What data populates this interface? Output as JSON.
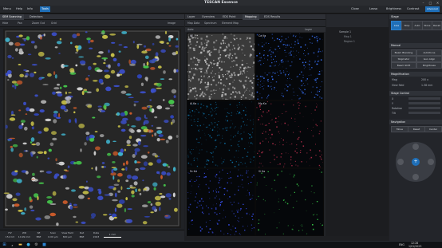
{
  "app": {
    "title": "TESCAN Essence"
  },
  "menubar": {
    "items_left": [
      "Menu",
      "Help",
      "Info",
      "Tools"
    ],
    "items_right": [
      "Close",
      "Lasso",
      "Brightness",
      "Contrast",
      "Advanced"
    ],
    "window_controls": [
      "–",
      "□",
      "✕"
    ]
  },
  "left_panel": {
    "tabs": [
      "SEM Scanning",
      "Detectors"
    ],
    "subbar": [
      "Hide",
      "Pan",
      "Zoom Out",
      "Grid"
    ],
    "image_label": "Image",
    "status": [
      {
        "label": "HV",
        "value": "15.0 kV"
      },
      {
        "label": "WD",
        "value": "14.99 mm"
      },
      {
        "label": "SE",
        "value": "BSE"
      },
      {
        "label": "Scan",
        "value": "0.00 µm"
      },
      {
        "label": "View field",
        "value": "820 µm"
      },
      {
        "label": "Det",
        "value": "BSE"
      },
      {
        "label": "Date",
        "value": "2023"
      }
    ],
    "scale_label": "1 mm"
  },
  "center_panel": {
    "tabs": [
      "Layer",
      "Overview",
      "EDS Point",
      "Mapping",
      "EDS Results"
    ],
    "subtabs": [
      "Map Data",
      "Spectrum",
      "Element Map"
    ],
    "dropdowns": [
      "Auto",
      "Layer"
    ],
    "maps": [
      {
        "label": "SE"
      },
      {
        "label": "Ca Kα"
      },
      {
        "label": "Al Kα"
      },
      {
        "label": "Mg Kα"
      },
      {
        "label": "Fe Kα"
      },
      {
        "label": "Si Kα"
      }
    ]
  },
  "tree_panel": {
    "title": "Sample 1",
    "items": [
      "Map 1",
      "Region 1"
    ]
  },
  "right_panel": {
    "sections": [
      {
        "title": "Stage",
        "buttons": [
          "Live",
          "Stop",
          "Auto",
          "Store",
          "Recall"
        ]
      },
      {
        "title": "Manual",
        "buttons": [
          "Beam Blanking",
          "Autofocus",
          "Stigmator",
          "Gun Align",
          "Beam Shift",
          "Brightness"
        ]
      },
      {
        "title": "Magnification",
        "values": [
          "Mag",
          "200 x",
          "View field",
          "1.38 mm"
        ]
      },
      {
        "title": "Stage Control",
        "values": [
          "X",
          "Y",
          "Rotation",
          "Tilt"
        ]
      },
      {
        "title": "Navigation",
        "values": [
          "Move",
          "Reset",
          "Center"
        ]
      }
    ]
  },
  "taskbar": {
    "icons": [
      "windows-logo",
      "search",
      "file-explorer",
      "edge",
      "settings",
      "app"
    ],
    "tray": [
      "ENG",
      "12:28",
      "1/01/2023"
    ]
  },
  "colors": {
    "accent": "#1f6fb8",
    "background": "#1e1f22",
    "map_se": "#b8b8b8",
    "map_ca": "#3a74ff",
    "map_al": "#0e6fa3",
    "map_mg": "#c23250",
    "map_fe": "#3c55ff",
    "map_si": "#39d24a"
  }
}
